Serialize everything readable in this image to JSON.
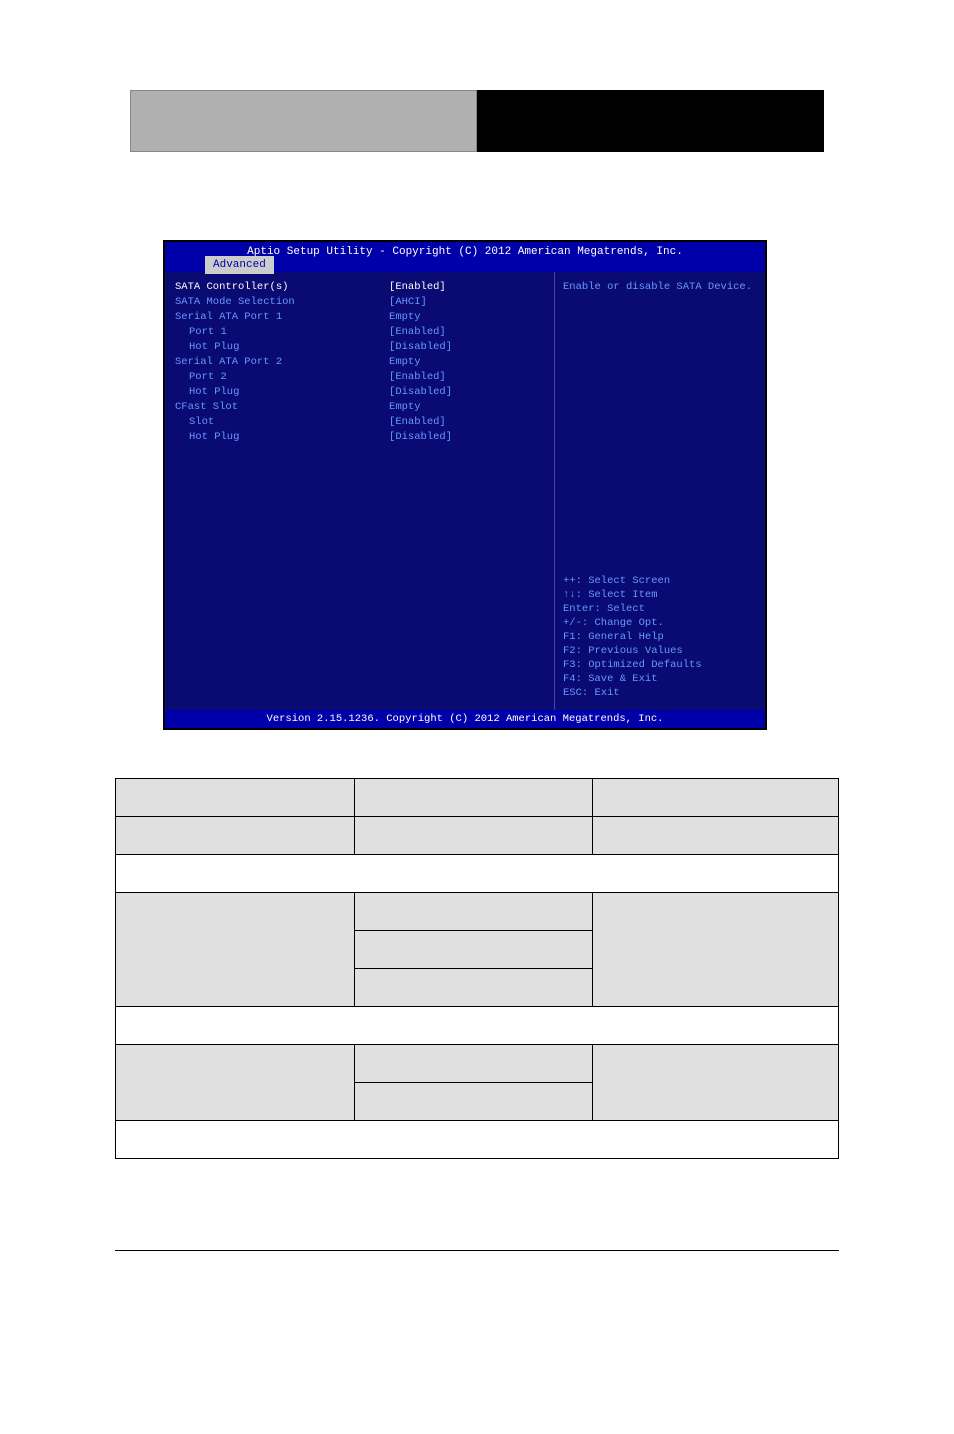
{
  "bios": {
    "title": "Aptio Setup Utility - Copyright (C) 2012 American Megatrends, Inc.",
    "tab": "Advanced",
    "help_text": "Enable or disable SATA Device.",
    "footer": "Version 2.15.1236. Copyright (C) 2012 American Megatrends, Inc.",
    "rows": [
      {
        "label": "SATA Controller(s)",
        "value": "[Enabled]",
        "highlight": true
      },
      {
        "label": "SATA Mode Selection",
        "value": "[AHCI]"
      },
      {
        "label": "",
        "value": ""
      },
      {
        "label": "Serial ATA Port 1",
        "value": "Empty"
      },
      {
        "label": "Port 1",
        "value": "[Enabled]",
        "sub": true
      },
      {
        "label": "Hot Plug",
        "value": "[Disabled]",
        "sub": true
      },
      {
        "label": "Serial ATA Port 2",
        "value": "Empty"
      },
      {
        "label": "Port 2",
        "value": "[Enabled]",
        "sub": true
      },
      {
        "label": "Hot Plug",
        "value": "[Disabled]",
        "sub": true
      },
      {
        "label": "CFast Slot",
        "value": "Empty"
      },
      {
        "label": "Slot",
        "value": "[Enabled]",
        "sub": true
      },
      {
        "label": "Hot Plug",
        "value": "[Disabled]",
        "sub": true
      }
    ],
    "keys": [
      "++: Select Screen",
      "↑↓: Select Item",
      "Enter: Select",
      "+/-: Change Opt.",
      "F1: General Help",
      "F2: Previous Values",
      "F3: Optimized Defaults",
      "F4: Save & Exit",
      "ESC: Exit"
    ]
  },
  "table": {
    "headers": {
      "c1": "",
      "c2": "",
      "c3": ""
    }
  }
}
